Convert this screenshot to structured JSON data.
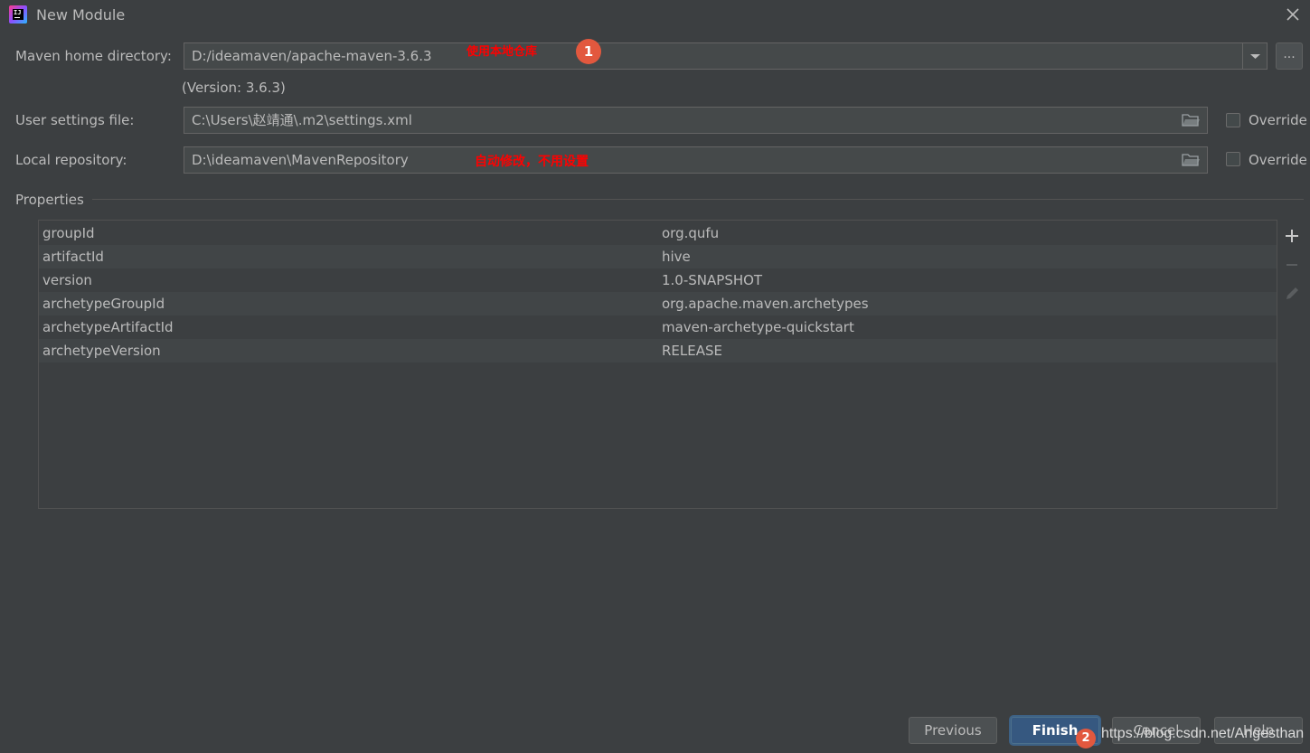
{
  "window": {
    "title": "New Module"
  },
  "maven_home": {
    "label": "Maven home directory:",
    "value": "D:/ideamaven/apache-maven-3.6.3",
    "version": "(Version: 3.6.3)",
    "browse_label": "...",
    "annotation": "使用本地仓库"
  },
  "user_settings": {
    "label": "User settings file:",
    "value": "C:\\Users\\赵靖通\\.m2\\settings.xml",
    "override_label": "Override"
  },
  "local_repo": {
    "label": "Local repository:",
    "value": "D:\\ideamaven\\MavenRepository",
    "override_label": "Override",
    "annotation": "自动修改，不用设置"
  },
  "properties": {
    "title": "Properties",
    "rows": [
      {
        "key": "groupId",
        "value": "org.qufu"
      },
      {
        "key": "artifactId",
        "value": "hive"
      },
      {
        "key": "version",
        "value": "1.0-SNAPSHOT"
      },
      {
        "key": "archetypeGroupId",
        "value": "org.apache.maven.archetypes"
      },
      {
        "key": "archetypeArtifactId",
        "value": "maven-archetype-quickstart"
      },
      {
        "key": "archetypeVersion",
        "value": "RELEASE"
      }
    ]
  },
  "buttons": {
    "previous": "Previous",
    "finish": "Finish",
    "cancel": "Cancel",
    "help": "Help"
  },
  "badges": {
    "one": "1",
    "two": "2"
  },
  "watermark": "https://blog.csdn.net/Angesthan",
  "icons": {
    "app": "intellij-idea-icon",
    "close": "close-icon",
    "dropdown": "chevron-down-icon",
    "folder": "folder-icon",
    "add": "plus-icon",
    "remove": "minus-icon",
    "edit": "pencil-icon"
  },
  "colors": {
    "background": "#3c3f41",
    "field": "#45494a",
    "annotation": "#ff0000",
    "badge": "#e2583e",
    "primary_button": "#365880"
  }
}
